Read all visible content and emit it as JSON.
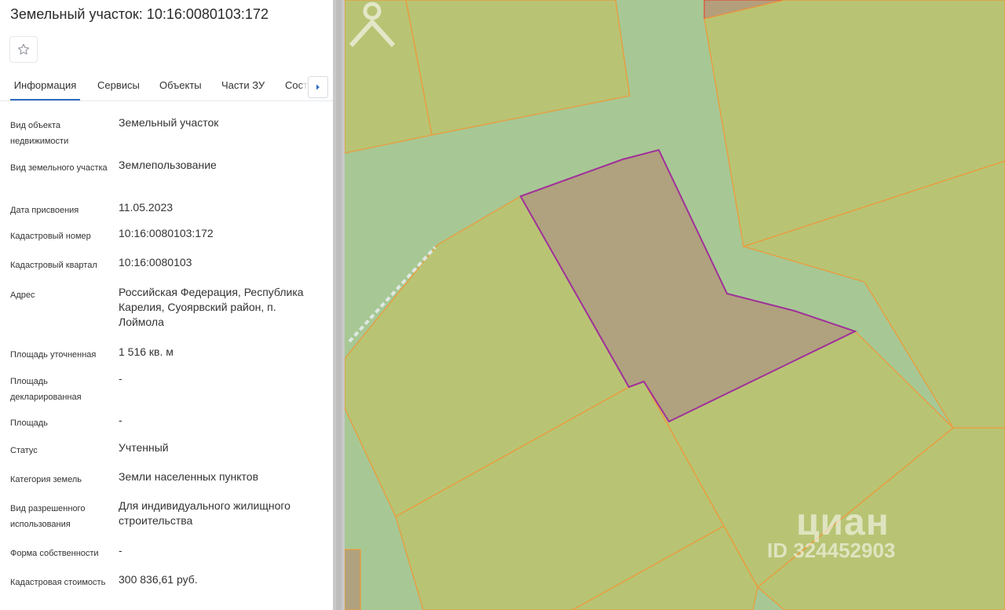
{
  "panel": {
    "title": "Земельный участок: 10:16:0080103:172",
    "tabs": [
      {
        "label": "Информация"
      },
      {
        "label": "Сервисы"
      },
      {
        "label": "Объекты"
      },
      {
        "label": "Части ЗУ"
      },
      {
        "label": "Сост"
      }
    ],
    "fields": [
      {
        "label": "Вид объекта недвижимости",
        "value": "Земельный участок"
      },
      {
        "label": "Вид земельного участка",
        "value": "Землепользование"
      },
      {
        "label": "Дата присвоения",
        "value": "11.05.2023"
      },
      {
        "label": "Кадастровый номер",
        "value": "10:16:0080103:172"
      },
      {
        "label": "Кадастровый квартал",
        "value": "10:16:0080103"
      },
      {
        "label": "Адрес",
        "value": "Российская Федерация, Республика Карелия, Суоярвский район, п. Лоймола"
      },
      {
        "label": "Площадь уточненная",
        "value": "1 516 кв. м"
      },
      {
        "label": "Площадь декларированная",
        "value": "-"
      },
      {
        "label": "Площадь",
        "value": "-"
      },
      {
        "label": "Статус",
        "value": "Учтенный"
      },
      {
        "label": "Категория земель",
        "value": "Земли населенных пунктов"
      },
      {
        "label": "Вид разрешенного использования",
        "value": "Для индивидуального жилищного строительства"
      },
      {
        "label": "Форма собственности",
        "value": "-"
      },
      {
        "label": "Кадастровая стоимость",
        "value": "300 836,61 руб."
      }
    ]
  },
  "icons": {
    "favorite": "star-outline-icon",
    "tabs_next": "caret-right-icon"
  },
  "map": {
    "watermark_brand": "циан",
    "watermark_id": "ID 324452903",
    "colors": {
      "road": "#a7c894",
      "parcel_fill": "#b8c474",
      "parcel_border": "#ec9a3c",
      "selected_fill": "#b0a27e",
      "selected_border": "#a0309a",
      "accent": "#2f6fc0"
    }
  }
}
